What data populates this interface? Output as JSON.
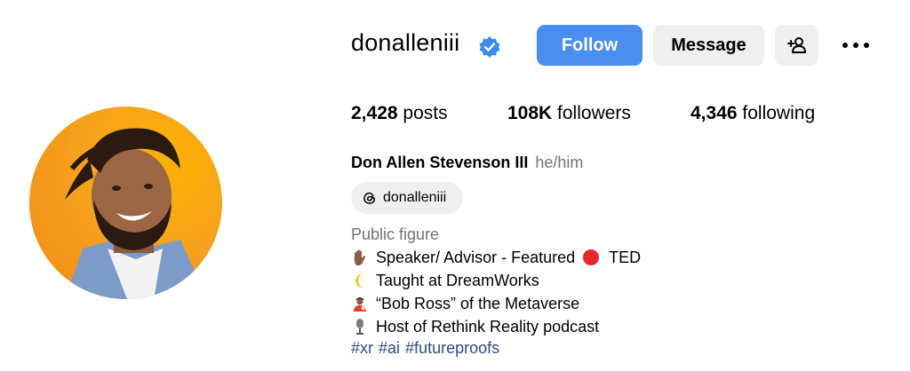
{
  "profile": {
    "username": "donalleniii",
    "verified": true,
    "follow_label": "Follow",
    "message_label": "Message",
    "stats": {
      "posts_count": "2,428",
      "posts_label": "posts",
      "followers_count": "108K",
      "followers_label": "followers",
      "following_count": "4,346",
      "following_label": "following"
    },
    "full_name": "Don Allen Stevenson III",
    "pronouns": "he/him",
    "threads_handle": "donalleniii",
    "category": "Public figure",
    "bio_lines": [
      {
        "icon": "raised-hand-emoji",
        "text": "Speaker/ Advisor - Featured",
        "trailing_icon": "red-circle-emoji",
        "trailing_text": "TED"
      },
      {
        "icon": "crescent-moon-emoji",
        "text": "Taught at DreamWorks"
      },
      {
        "icon": "artist-emoji",
        "text": "“Bob Ross” of the Metaverse"
      },
      {
        "icon": "microphone-emoji",
        "text": "Host of Rethink Reality podcast"
      }
    ],
    "hashtags": [
      "#xr",
      "#ai",
      "#futureproofs"
    ]
  },
  "colors": {
    "follow_button": "#4a8ef0",
    "secondary_button": "#efefef",
    "verified_badge": "#3b8cf0",
    "hashtag": "#2b4a8c",
    "muted_text": "#737373",
    "avatar_bg": "#f7a21c"
  }
}
